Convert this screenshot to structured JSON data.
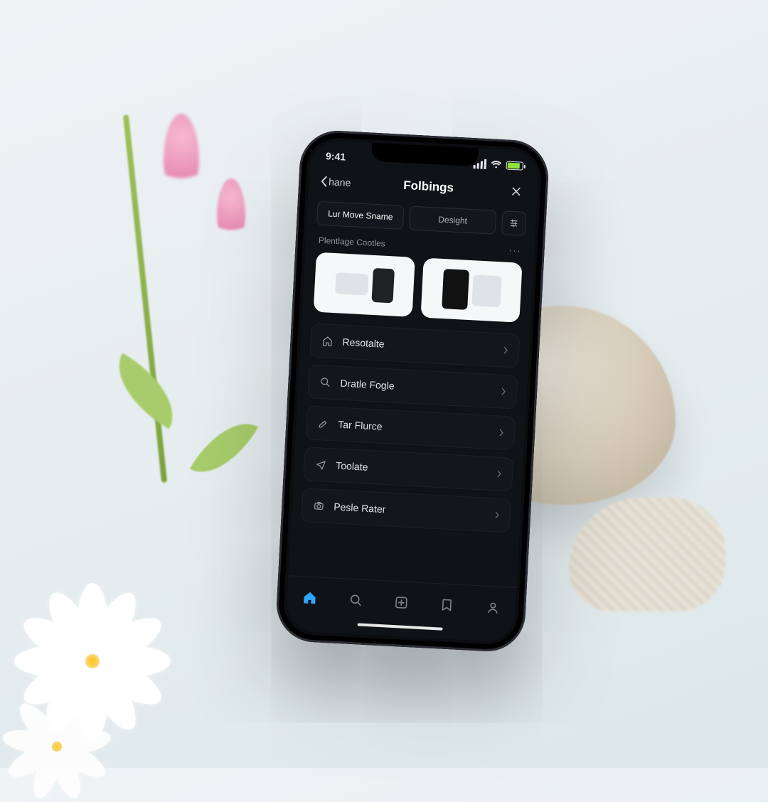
{
  "status": {
    "time": "9:41"
  },
  "header": {
    "back_label": "hane",
    "title": "Folbings"
  },
  "tabs": {
    "items": [
      {
        "label": "Lur Move Sname"
      },
      {
        "label": "Desight"
      }
    ]
  },
  "section": {
    "label": "Plentlage Cootles",
    "more": "···"
  },
  "list": {
    "items": [
      {
        "label": "Resotalte"
      },
      {
        "label": "Dratle Fogle"
      },
      {
        "label": "Tar Flurce"
      },
      {
        "label": "Toolate"
      },
      {
        "label": "Pesle Rater"
      }
    ]
  },
  "colors": {
    "accent": "#2aa8ff"
  }
}
